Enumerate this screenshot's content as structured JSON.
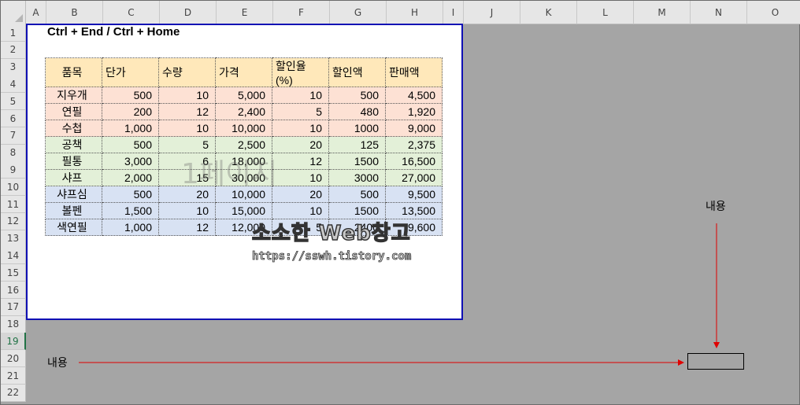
{
  "columns": [
    "A",
    "B",
    "C",
    "D",
    "E",
    "F",
    "G",
    "H",
    "I",
    "J",
    "K",
    "L",
    "M",
    "N",
    "O"
  ],
  "rows": [
    "1",
    "2",
    "3",
    "4",
    "5",
    "6",
    "7",
    "8",
    "9",
    "10",
    "11",
    "12",
    "13",
    "14",
    "15",
    "16",
    "17",
    "18",
    "19",
    "20",
    "21",
    "22"
  ],
  "selected_row": "19",
  "title": "Ctrl + End / Ctrl + Home",
  "table": {
    "headers": [
      "품목",
      "단가",
      "수량",
      "가격",
      "할인율(%)",
      "할인액",
      "판매액"
    ],
    "rows": [
      [
        "지우개",
        "500",
        "10",
        "5,000",
        "10",
        "500",
        "4,500"
      ],
      [
        "연필",
        "200",
        "12",
        "2,400",
        "5",
        "480",
        "1,920"
      ],
      [
        "수첩",
        "1,000",
        "10",
        "10,000",
        "10",
        "1000",
        "9,000"
      ],
      [
        "공책",
        "500",
        "5",
        "2,500",
        "20",
        "125",
        "2,375"
      ],
      [
        "필통",
        "3,000",
        "6",
        "18,000",
        "12",
        "1500",
        "16,500"
      ],
      [
        "샤프",
        "2,000",
        "15",
        "30,000",
        "10",
        "3000",
        "27,000"
      ],
      [
        "샤프심",
        "500",
        "20",
        "10,000",
        "20",
        "500",
        "9,500"
      ],
      [
        "볼펜",
        "1,500",
        "10",
        "15,000",
        "10",
        "1500",
        "13,500"
      ],
      [
        "색연필",
        "1,000",
        "12",
        "12,000",
        "5",
        "2400",
        "9,600"
      ]
    ]
  },
  "page_watermark": "1페이지",
  "logo_text": "소소한 Web창고",
  "logo_url": "https://sswh.tistory.com",
  "label_top": "내용",
  "label_left": "내용",
  "colors": {
    "page_border": "#1010b4",
    "arrow": "#e00000",
    "header_fill": "#ffe8ba",
    "group1": "#fde1d4",
    "group2": "#e3f0d8",
    "group3": "#d8e2f3"
  }
}
